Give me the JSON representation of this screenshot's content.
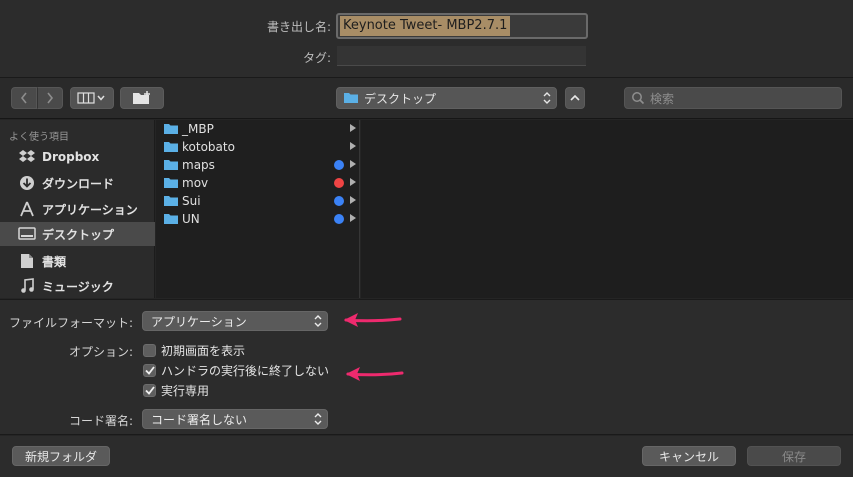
{
  "header": {
    "save_as_label": "書き出し名:",
    "save_as_value": "Keynote Tweet- MBP2.7.1",
    "tags_label": "タグ:",
    "tags_value": ""
  },
  "toolbar": {
    "back_icon": "chevron-left-icon",
    "forward_icon": "chevron-right-icon",
    "view_icon": "column-view-icon",
    "new_folder_icon": "new-folder-icon",
    "location": "デスクトップ",
    "search_placeholder": "検索"
  },
  "sidebar": {
    "heading": "よく使う項目",
    "items": [
      {
        "label": "Dropbox",
        "icon": "dropbox-icon",
        "active": false
      },
      {
        "label": "ダウンロード",
        "icon": "download-icon",
        "active": false
      },
      {
        "label": "アプリケーション",
        "icon": "applications-icon",
        "active": false
      },
      {
        "label": "デスクトップ",
        "icon": "desktop-icon",
        "active": true
      },
      {
        "label": "書類",
        "icon": "documents-icon",
        "active": false
      },
      {
        "label": "ミュージック",
        "icon": "music-icon",
        "active": false
      }
    ]
  },
  "browser": {
    "items": [
      {
        "name": "_MBP",
        "tag_color": ""
      },
      {
        "name": "kotobato",
        "tag_color": ""
      },
      {
        "name": "maps",
        "tag_color": "#3b82f6"
      },
      {
        "name": "mov",
        "tag_color": "#ef4444"
      },
      {
        "name": "Sui",
        "tag_color": "#3b82f6"
      },
      {
        "name": "UN",
        "tag_color": "#3b82f6"
      }
    ]
  },
  "options": {
    "format_label": "ファイルフォーマット:",
    "format_value": "アプリケーション",
    "options_label": "オプション:",
    "checkboxes": [
      {
        "label": "初期画面を表示",
        "checked": false
      },
      {
        "label": "ハンドラの実行後に終了しない",
        "checked": true
      },
      {
        "label": "実行専用",
        "checked": true
      }
    ],
    "codesign_label": "コード署名:",
    "codesign_value": "コード署名しない"
  },
  "footer": {
    "new_folder": "新規フォルダ",
    "cancel": "キャンセル",
    "save": "保存"
  },
  "colors": {
    "annotation_arrow": "#ee2a6e",
    "selection": "#a88d66",
    "folder": "#5bb0e6"
  }
}
